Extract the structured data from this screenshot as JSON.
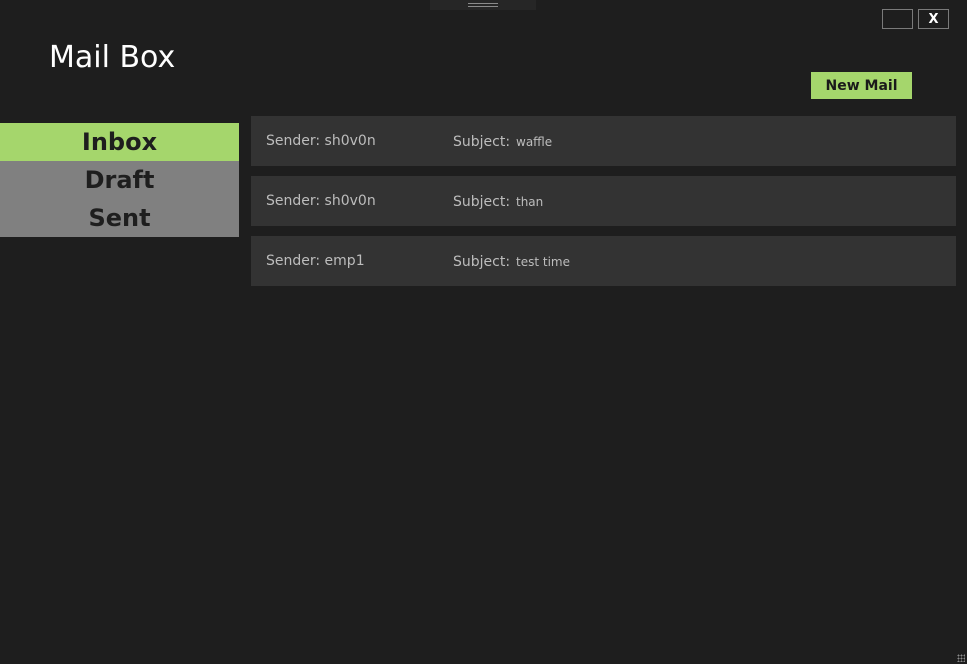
{
  "window": {
    "minimize_label": "",
    "close_label": "X"
  },
  "app": {
    "title": "Mail Box"
  },
  "toolbar": {
    "new_mail_label": "New Mail"
  },
  "folders": [
    {
      "label": "Inbox",
      "active": true
    },
    {
      "label": "Draft",
      "active": false
    },
    {
      "label": "Sent",
      "active": false
    }
  ],
  "mail_list": {
    "subject_label": "Subject:",
    "rows": [
      {
        "sender": "Sender: sh0v0n",
        "subject": "waffle"
      },
      {
        "sender": "Sender: sh0v0n",
        "subject": "than"
      },
      {
        "sender": "Sender: emp1",
        "subject": "test time"
      }
    ]
  },
  "colors": {
    "background": "#1e1e1e",
    "accent": "#a5d66c",
    "folder_inactive": "#808080",
    "row_background": "#333333"
  }
}
